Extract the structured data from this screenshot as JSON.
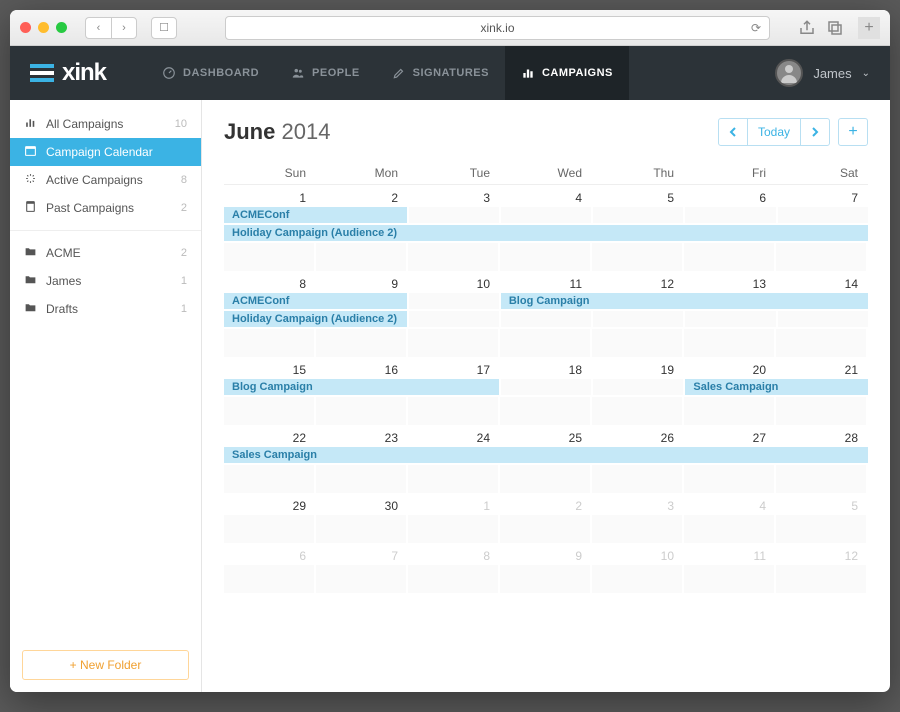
{
  "browser": {
    "url": "xink.io"
  },
  "brand": "xink",
  "nav": [
    {
      "label": "DASHBOARD"
    },
    {
      "label": "PEOPLE"
    },
    {
      "label": "SIGNATURES"
    },
    {
      "label": "CAMPAIGNS",
      "active": true
    }
  ],
  "user": {
    "name": "James"
  },
  "sidebar": {
    "groups": [
      [
        {
          "label": "All Campaigns",
          "count": "10"
        },
        {
          "label": "Campaign Calendar",
          "active": true
        },
        {
          "label": "Active Campaigns",
          "count": "8"
        },
        {
          "label": "Past Campaigns",
          "count": "2"
        }
      ],
      [
        {
          "label": "ACME",
          "count": "2"
        },
        {
          "label": "James",
          "count": "1"
        },
        {
          "label": "Drafts",
          "count": "1"
        }
      ]
    ],
    "new_folder": "New Folder"
  },
  "calendar": {
    "month": "June",
    "year": "2014",
    "today_label": "Today",
    "day_names": [
      "Sun",
      "Mon",
      "Tue",
      "Wed",
      "Thu",
      "Fri",
      "Sat"
    ],
    "weeks": [
      {
        "days": [
          {
            "n": "1"
          },
          {
            "n": "2"
          },
          {
            "n": "3"
          },
          {
            "n": "4"
          },
          {
            "n": "5"
          },
          {
            "n": "6"
          },
          {
            "n": "7"
          }
        ],
        "events": [
          {
            "label": "ACMEConf",
            "start": 0,
            "span": 2
          },
          {
            "label": "Holiday Campaign (Audience 2)",
            "start": 0,
            "span": 7
          }
        ]
      },
      {
        "days": [
          {
            "n": "8"
          },
          {
            "n": "9"
          },
          {
            "n": "10"
          },
          {
            "n": "11"
          },
          {
            "n": "12"
          },
          {
            "n": "13"
          },
          {
            "n": "14"
          }
        ],
        "events": [
          {
            "label": "ACMEConf",
            "start": 0,
            "span": 2
          },
          {
            "label": "Blog Campaign",
            "start": 3,
            "span": 4,
            "row": 0
          },
          {
            "label": "Holiday Campaign (Audience 2)",
            "start": 0,
            "span": 2
          }
        ]
      },
      {
        "days": [
          {
            "n": "15"
          },
          {
            "n": "16"
          },
          {
            "n": "17"
          },
          {
            "n": "18"
          },
          {
            "n": "19"
          },
          {
            "n": "20"
          },
          {
            "n": "21"
          }
        ],
        "events": [
          {
            "label": "Blog Campaign",
            "start": 0,
            "span": 3
          },
          {
            "label": "Sales Campaign",
            "start": 5,
            "span": 2,
            "row": 0
          }
        ]
      },
      {
        "days": [
          {
            "n": "22"
          },
          {
            "n": "23"
          },
          {
            "n": "24"
          },
          {
            "n": "25"
          },
          {
            "n": "26"
          },
          {
            "n": "27"
          },
          {
            "n": "28"
          }
        ],
        "events": [
          {
            "label": "Sales Campaign",
            "start": 0,
            "span": 7
          }
        ]
      },
      {
        "days": [
          {
            "n": "29"
          },
          {
            "n": "30"
          },
          {
            "n": "1",
            "dim": true
          },
          {
            "n": "2",
            "dim": true
          },
          {
            "n": "3",
            "dim": true
          },
          {
            "n": "4",
            "dim": true
          },
          {
            "n": "5",
            "dim": true
          }
        ],
        "events": []
      },
      {
        "days": [
          {
            "n": "6",
            "dim": true
          },
          {
            "n": "7",
            "dim": true
          },
          {
            "n": "8",
            "dim": true
          },
          {
            "n": "9",
            "dim": true
          },
          {
            "n": "10",
            "dim": true
          },
          {
            "n": "11",
            "dim": true
          },
          {
            "n": "12",
            "dim": true
          }
        ],
        "events": []
      }
    ]
  }
}
